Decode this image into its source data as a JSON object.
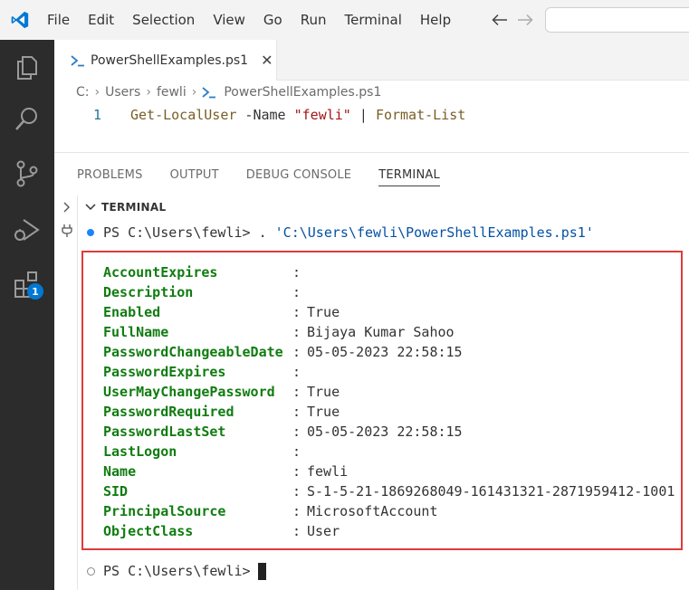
{
  "menu": [
    "File",
    "Edit",
    "Selection",
    "View",
    "Go",
    "Run",
    "Terminal",
    "Help"
  ],
  "editor": {
    "tab_label": "PowerShellExamples.ps1",
    "breadcrumb": [
      "C:",
      "Users",
      "fewli",
      "PowerShellExamples.ps1"
    ],
    "line_number": "1",
    "code": {
      "cmd1": "Get-LocalUser",
      "param": " -Name ",
      "str": "\"fewli\"",
      "pipe": " | ",
      "cmd2": "Format-List"
    }
  },
  "activity": {
    "extensions_badge": "1"
  },
  "panel": {
    "tabs": [
      "PROBLEMS",
      "OUTPUT",
      "DEBUG CONSOLE",
      "TERMINAL"
    ],
    "active_tab": "TERMINAL",
    "section_header": "TERMINAL"
  },
  "terminal": {
    "prompt1": "PS C:\\Users\\fewli> ",
    "command1": ". ",
    "command1_path": "'C:\\Users\\fewli\\PowerShellExamples.ps1'",
    "prompt2": "PS C:\\Users\\fewli>",
    "properties": [
      {
        "name": "AccountExpires",
        "value": ""
      },
      {
        "name": "Description",
        "value": ""
      },
      {
        "name": "Enabled",
        "value": "True"
      },
      {
        "name": "FullName",
        "value": "Bijaya Kumar Sahoo"
      },
      {
        "name": "PasswordChangeableDate",
        "value": "05-05-2023 22:58:15"
      },
      {
        "name": "PasswordExpires",
        "value": ""
      },
      {
        "name": "UserMayChangePassword",
        "value": "True"
      },
      {
        "name": "PasswordRequired",
        "value": "True"
      },
      {
        "name": "PasswordLastSet",
        "value": "05-05-2023 22:58:15"
      },
      {
        "name": "LastLogon",
        "value": ""
      },
      {
        "name": "Name",
        "value": "fewli"
      },
      {
        "name": "SID",
        "value": "S-1-5-21-1869268049-161431321-2871959412-1001"
      },
      {
        "name": "PrincipalSource",
        "value": "MicrosoftAccount"
      },
      {
        "name": "ObjectClass",
        "value": "User"
      }
    ],
    "separator": ": "
  }
}
